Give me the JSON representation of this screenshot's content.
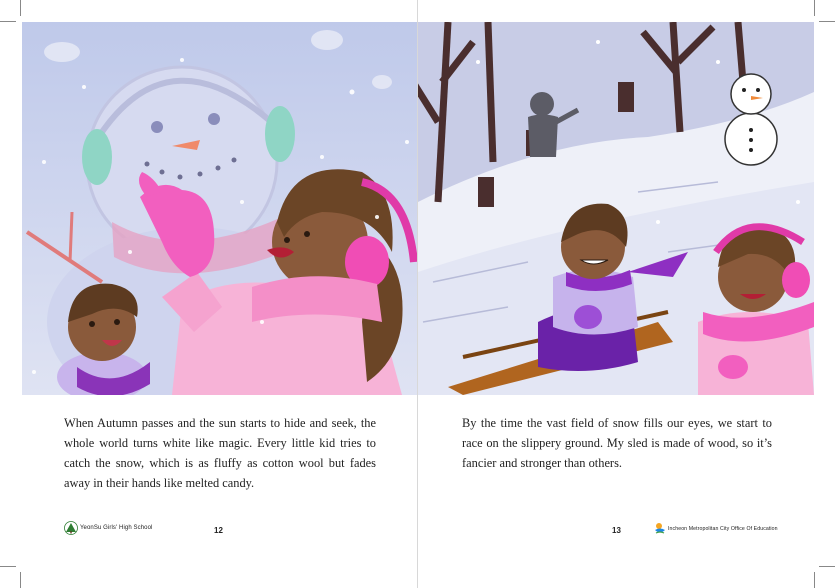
{
  "left_page": {
    "paragraph": "When Autumn passes and the sun starts to hide and seek, the whole world turns white like magic. Every little kid tries to catch the snow, which is as fluffy as cotton wool but fades away in their hands like melted candy.",
    "page_number": "12",
    "footer_text": "YeonSu Girls' High School",
    "footer_icon": "tree-logo-icon",
    "illustration_icon": "snowman-kids-illustration"
  },
  "right_page": {
    "paragraph": "By the time the vast field of snow fills our eyes, we start to race on the slippery ground. My sled is made of wood, so it’s fancier and stronger than others.",
    "page_number": "13",
    "footer_text": "Incheon Metropolitan City Office Of Education",
    "footer_icon": "education-office-logo-icon",
    "illustration_icon": "sledding-kids-illustration"
  },
  "colors": {
    "sky": "#c9d2ec",
    "snow": "#eef0f8",
    "pink_jacket": "#f59fcc",
    "magenta": "#e03aa8",
    "purple": "#7a2fb0",
    "skin": "#8a5a3b",
    "hair": "#6b4526",
    "wood": "#b0651f"
  }
}
